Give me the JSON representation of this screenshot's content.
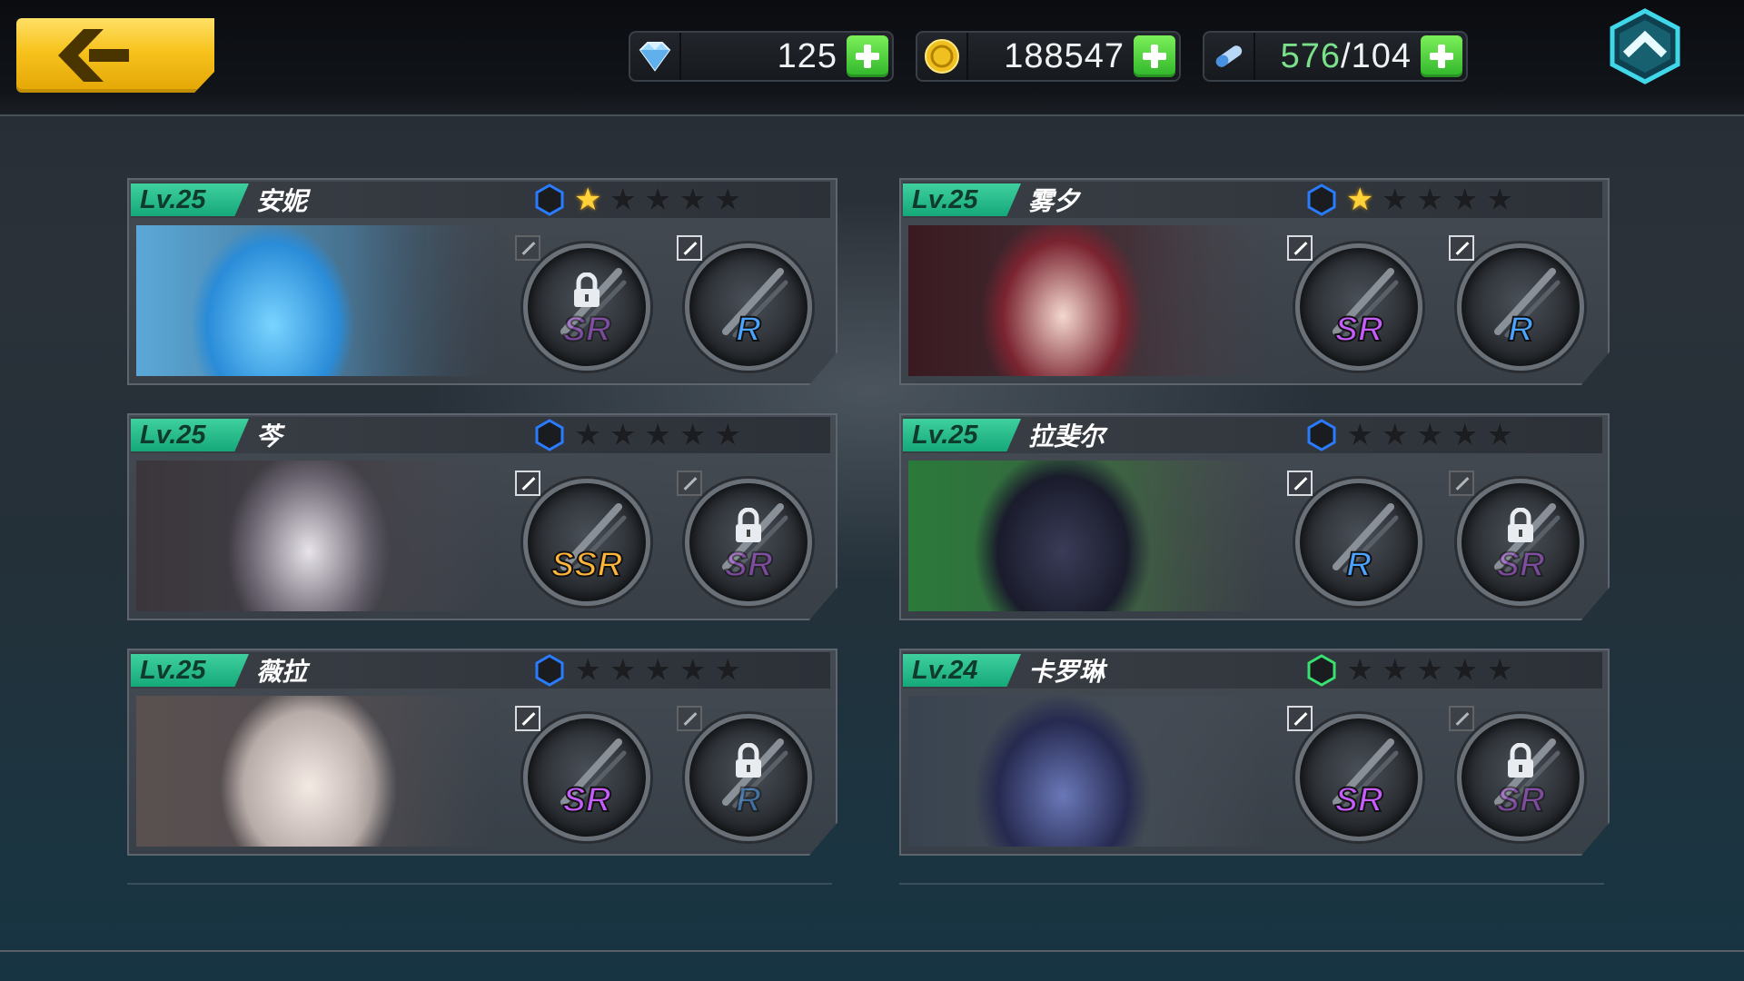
{
  "resources": {
    "diamonds": {
      "icon": "diamond-icon",
      "value": "125"
    },
    "gold": {
      "icon": "coin-icon",
      "value": "188547"
    },
    "stamina": {
      "icon": "stamina-icon",
      "current": "576",
      "sep": "/",
      "max": "104"
    }
  },
  "characters": [
    {
      "level": "Lv.25",
      "name": "安妮",
      "stars": 1,
      "hex": "#2a7cff",
      "weapons": [
        {
          "rarity": "SR",
          "locked": true,
          "edit": false
        },
        {
          "rarity": "R",
          "locked": false,
          "edit": true
        }
      ]
    },
    {
      "level": "Lv.25",
      "name": "雾夕",
      "stars": 1,
      "hex": "#2a7cff",
      "weapons": [
        {
          "rarity": "SR",
          "locked": false,
          "edit": true
        },
        {
          "rarity": "R",
          "locked": false,
          "edit": true
        }
      ]
    },
    {
      "level": "Lv.25",
      "name": "芩",
      "stars": 0,
      "hex": "#2a7cff",
      "weapons": [
        {
          "rarity": "SSR",
          "locked": false,
          "edit": true
        },
        {
          "rarity": "SR",
          "locked": true,
          "edit": false
        }
      ]
    },
    {
      "level": "Lv.25",
      "name": "拉斐尔",
      "stars": 0,
      "hex": "#2a7cff",
      "weapons": [
        {
          "rarity": "R",
          "locked": false,
          "edit": true
        },
        {
          "rarity": "SR",
          "locked": true,
          "edit": false
        }
      ]
    },
    {
      "level": "Lv.25",
      "name": "薇拉",
      "stars": 0,
      "hex": "#2a7cff",
      "weapons": [
        {
          "rarity": "SR",
          "locked": false,
          "edit": true
        },
        {
          "rarity": "R",
          "locked": true,
          "edit": false
        }
      ]
    },
    {
      "level": "Lv.24",
      "name": "卡罗琳",
      "stars": 0,
      "hex": "#38e070",
      "weapons": [
        {
          "rarity": "SR",
          "locked": false,
          "edit": true
        },
        {
          "rarity": "SR",
          "locked": true,
          "edit": false
        }
      ]
    }
  ],
  "colors": {
    "accent_gold": "#f7c21c",
    "level_green": "#15a878",
    "plus_green": "#2fb52a"
  }
}
